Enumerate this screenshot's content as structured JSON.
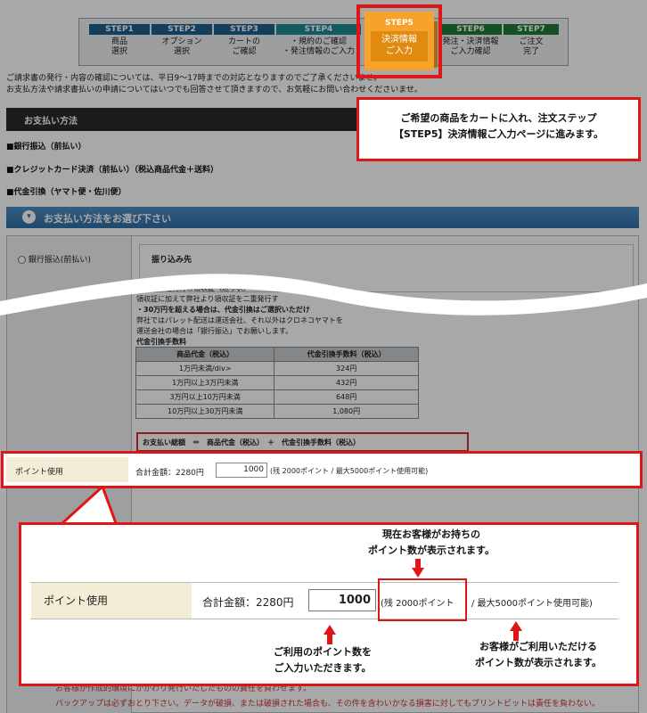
{
  "steps": [
    {
      "head": "STEP1",
      "label": "商品\n選択"
    },
    {
      "head": "STEP2",
      "label": "オプション\n選択"
    },
    {
      "head": "STEP3",
      "label": "カートの\nご確認"
    },
    {
      "head": "STEP4",
      "label": "・規約のご確認\n・発注情報のご入力"
    },
    {
      "head": "STEP5",
      "label": "決済情報\nご入力"
    },
    {
      "head": "STEP6",
      "label": "発注・決済情報\nご入力確認"
    },
    {
      "head": "STEP7",
      "label": "ご注文\n完了"
    }
  ],
  "notice": {
    "line1": "ご請求書の発行・内容の確認については、平日9〜17時までの対応となりますのでご了承くださいませ。",
    "line2": "お支払方法や請求書払いの申請についてはいつでも回答させて頂きますので、お気軽にお問い合わせくださいませ。"
  },
  "callout_step": {
    "line1": "ご希望の商品をカートに入れ、注文ステップ",
    "line2": "【STEP5】決済情報ご入力ページに進みます。"
  },
  "payment_header": "お支払い方法",
  "payment_methods": [
    "■銀行振込（前払い）",
    "■クレジットカード決済（前払い）（税込商品代金＋送料）",
    "■代金引換（ヤマト便・佐川便）"
  ],
  "select_header": "お支払い方法をお選び下さい",
  "radio_bank": "銀行振込(前払い)",
  "furikomi": "振り込み先",
  "details": {
    "line1": "各配送会社発行の領収証（送り状）",
    "line2": "領収証に加えて弊社より領収証を二重発行す",
    "line3": "・30万円を超える場合は、代金引換はご選択いただけ",
    "line4": "弊社ではパレット配送は運送会社、それ以外はクロネコヤマトを",
    "line5": "運送会社の場合は「銀行振込」でお願いします。",
    "fee_title": "代金引換手数料"
  },
  "fee_table": {
    "headers": [
      "商品代金（税込）",
      "代金引換手数料（税込）"
    ],
    "rows": [
      [
        "1万円未満/div>",
        "324円"
      ],
      [
        "1万円以上3万円未満",
        "432円"
      ],
      [
        "3万円以上10万円未満",
        "648円"
      ],
      [
        "10万円以上30万円未満",
        "1,080円"
      ]
    ]
  },
  "total_formula": "お支払い総額　＝　商品代金（税込）　＋　代金引換手数料（税込）",
  "points_row": {
    "label": "ポイント使用",
    "total": "合計金額：2280円",
    "input_value": "1000",
    "remaining": "(残 2000ポイント",
    "max": " / 最大5000ポイント使用可能)"
  },
  "zoom": {
    "label": "ポイント使用",
    "total": "合計金額：2280円",
    "input_value": "1000",
    "remaining": "(残 2000ポイント",
    "max": " / 最大5000ポイント使用可能)",
    "tip_top1": "現在お客様がお持ちの",
    "tip_top2": "ポイント数が表示されます。",
    "tip_left1": "ご利用のポイント数を",
    "tip_left2": "ご入力いただきます。",
    "tip_right1": "お客様がご利用いただける",
    "tip_right2": "ポイント数が表示されます。"
  },
  "footer_lines": [
    "お客様が作成的環境にかかわり発行いたしたものの責任を負わせます。",
    "バックアップは必ずおとり下さい。データが破損、または破損された場合も、その件を含わいかなる損害に対してもプリントビットは責任を負わない。"
  ],
  "colors": {
    "step_blue": "#1f5f8f",
    "step_teal": "#1b8a93",
    "step_green": "#1d7a36",
    "step_active": "#f7a22a",
    "highlight": "#e01616"
  }
}
